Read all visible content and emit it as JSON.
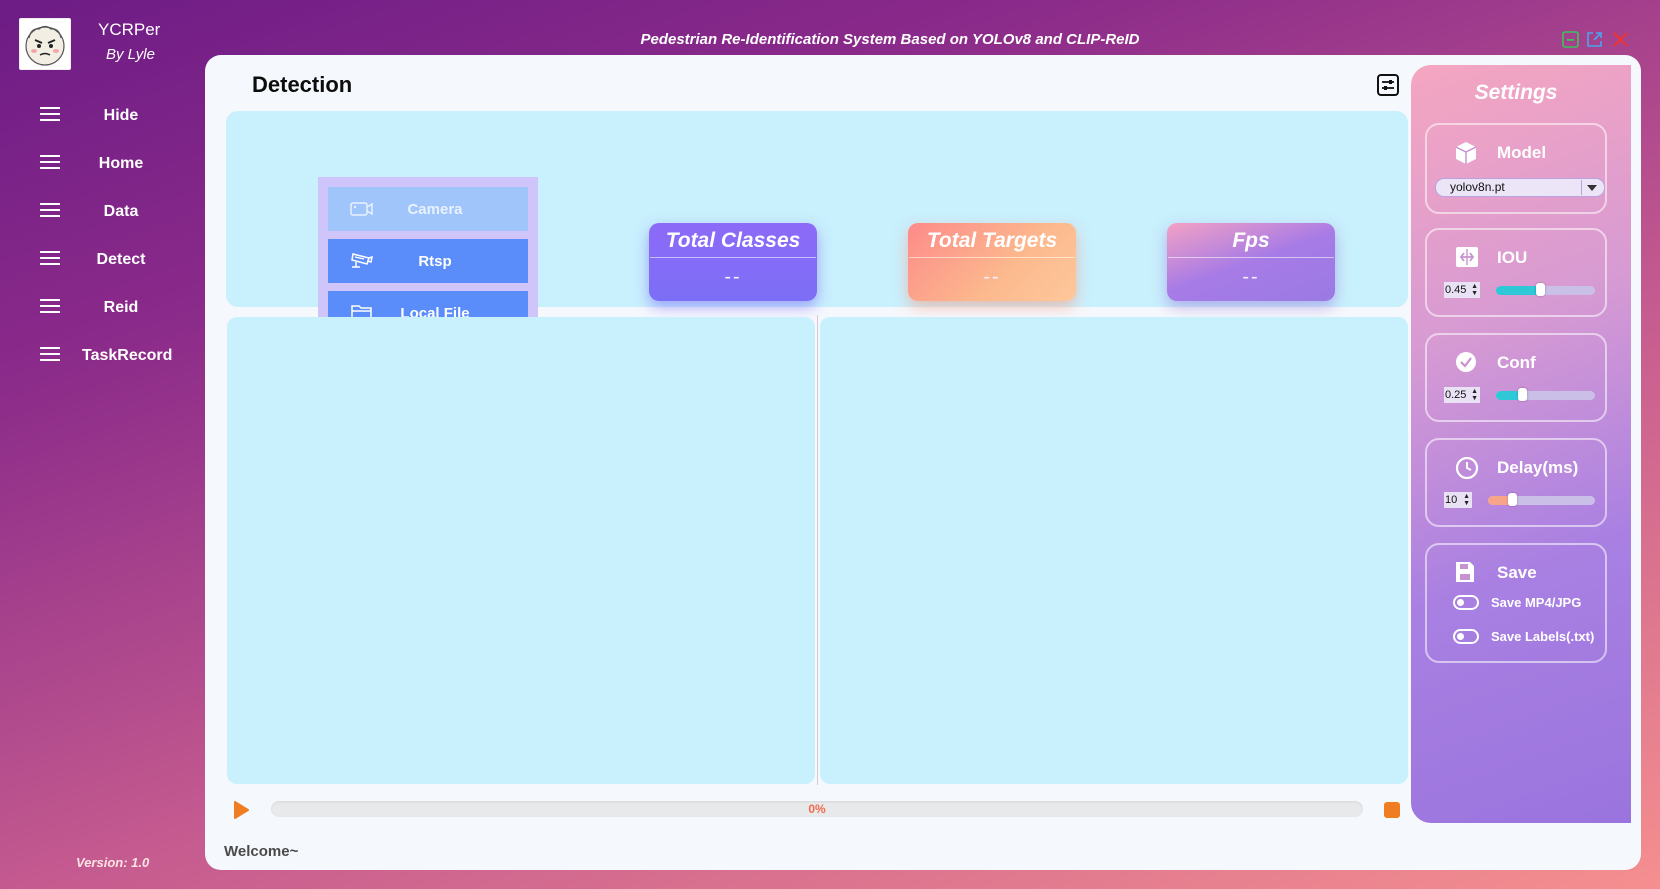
{
  "app": {
    "name": "YCRPer",
    "author": "By Lyle",
    "version": "Version: 1.0",
    "title": "Pedestrian Re-Identification System Based on YOLOv8 and CLIP-ReID"
  },
  "sidebar": {
    "items": [
      {
        "label": "Hide"
      },
      {
        "label": "Home"
      },
      {
        "label": "Data"
      },
      {
        "label": "Detect"
      },
      {
        "label": "Reid"
      },
      {
        "label": "TaskRecord"
      }
    ]
  },
  "page": {
    "title": "Detection"
  },
  "sources": {
    "camera": "Camera",
    "rtsp": "Rtsp",
    "local_file": "Local File"
  },
  "stats": {
    "total_classes": {
      "label": "Total Classes",
      "value": "--"
    },
    "total_targets": {
      "label": "Total Targets",
      "value": "--"
    },
    "fps": {
      "label": "Fps",
      "value": "--"
    }
  },
  "playback": {
    "progress_text": "0%",
    "progress": 0
  },
  "status": {
    "message": "Welcome~"
  },
  "settings": {
    "title": "Settings",
    "model": {
      "label": "Model",
      "value": "yolov8n.pt"
    },
    "iou": {
      "label": "IOU",
      "value": "0.45",
      "slider_fraction": 0.45
    },
    "conf": {
      "label": "Conf",
      "value": "0.25",
      "slider_fraction": 0.25
    },
    "delay": {
      "label": "Delay(ms)",
      "value": "10",
      "slider_fraction": 0.2
    },
    "save": {
      "label": "Save",
      "save_media": {
        "label": "Save MP4/JPG",
        "on": false
      },
      "save_labels": {
        "label": "Save Labels(.txt)",
        "on": false
      }
    }
  },
  "colors": {
    "accent_blue": "#5b8dfa",
    "slider_teal": "#2ec8d6",
    "slider_peach": "#f8a48a",
    "stop_orange": "#f07d21",
    "card_bg": "#c9f0fd"
  }
}
